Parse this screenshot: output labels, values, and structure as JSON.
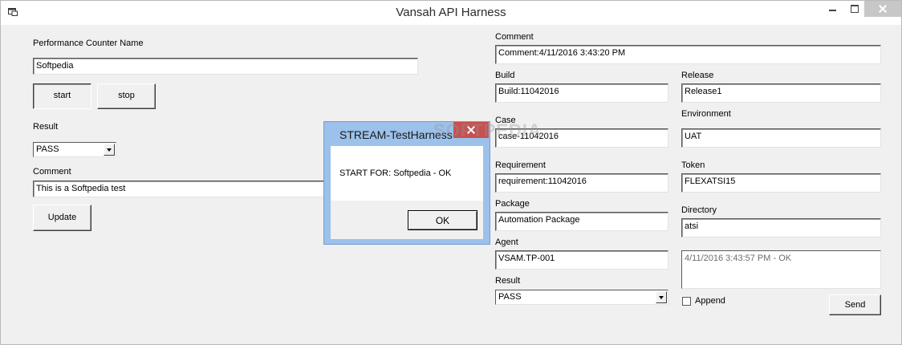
{
  "window": {
    "title": "Vansah API Harness"
  },
  "left_panel": {
    "perf_counter_label": "Performance Counter Name",
    "perf_counter_value": "Softpedia",
    "start_label": "start",
    "stop_label": "stop",
    "result_label": "Result",
    "result_value": "PASS",
    "comment_label": "Comment",
    "comment_value": "This is a Softpedia test",
    "update_label": "Update"
  },
  "right_panel": {
    "comment_label": "Comment",
    "comment_value": "Comment:4/11/2016 3:43:20 PM",
    "build_label": "Build",
    "build_value": "Build:11042016",
    "release_label": "Release",
    "release_value": "Release1",
    "case_label": "Case",
    "case_value": "case-11042016",
    "environment_label": "Environment",
    "environment_value": "UAT",
    "requirement_label": "Requirement",
    "requirement_value": "requirement:11042016",
    "token_label": "Token",
    "token_value": "FLEXATSI15",
    "package_label": "Package",
    "package_value": "Automation Package",
    "directory_label": "Directory",
    "directory_value": "atsi",
    "agent_label": "Agent",
    "agent_value": "VSAM.TP-001",
    "log_value": "4/11/2016 3:43:57 PM - OK",
    "result_label": "Result",
    "result_value": "PASS",
    "append_label": "Append",
    "send_label": "Send"
  },
  "dialog": {
    "title": "STREAM-TestHarness",
    "message": "START FOR: Softpedia - OK",
    "ok_label": "OK"
  },
  "watermark": "SOFTPEDIA"
}
